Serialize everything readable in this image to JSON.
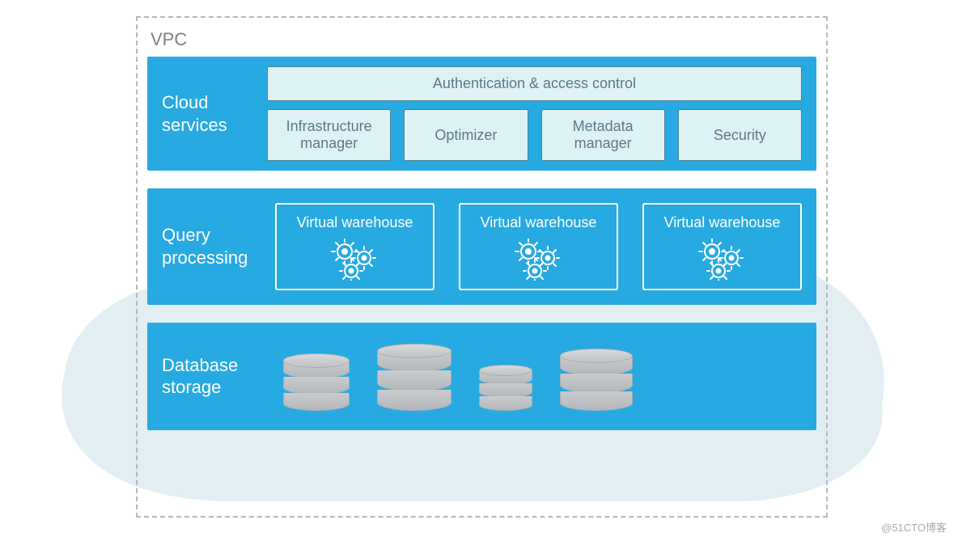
{
  "vpc_label": "VPC",
  "layers": {
    "cloud_services": {
      "title": "Cloud services",
      "auth_label": "Authentication & access control",
      "boxes": {
        "infra": "Infrastructure manager",
        "optimizer": "Optimizer",
        "metadata": "Metadata manager",
        "security": "Security"
      }
    },
    "query_processing": {
      "title": "Query processing",
      "warehouse_label": "Virtual warehouse"
    },
    "database_storage": {
      "title": "Database storage"
    }
  },
  "watermark": "@51CTO博客"
}
